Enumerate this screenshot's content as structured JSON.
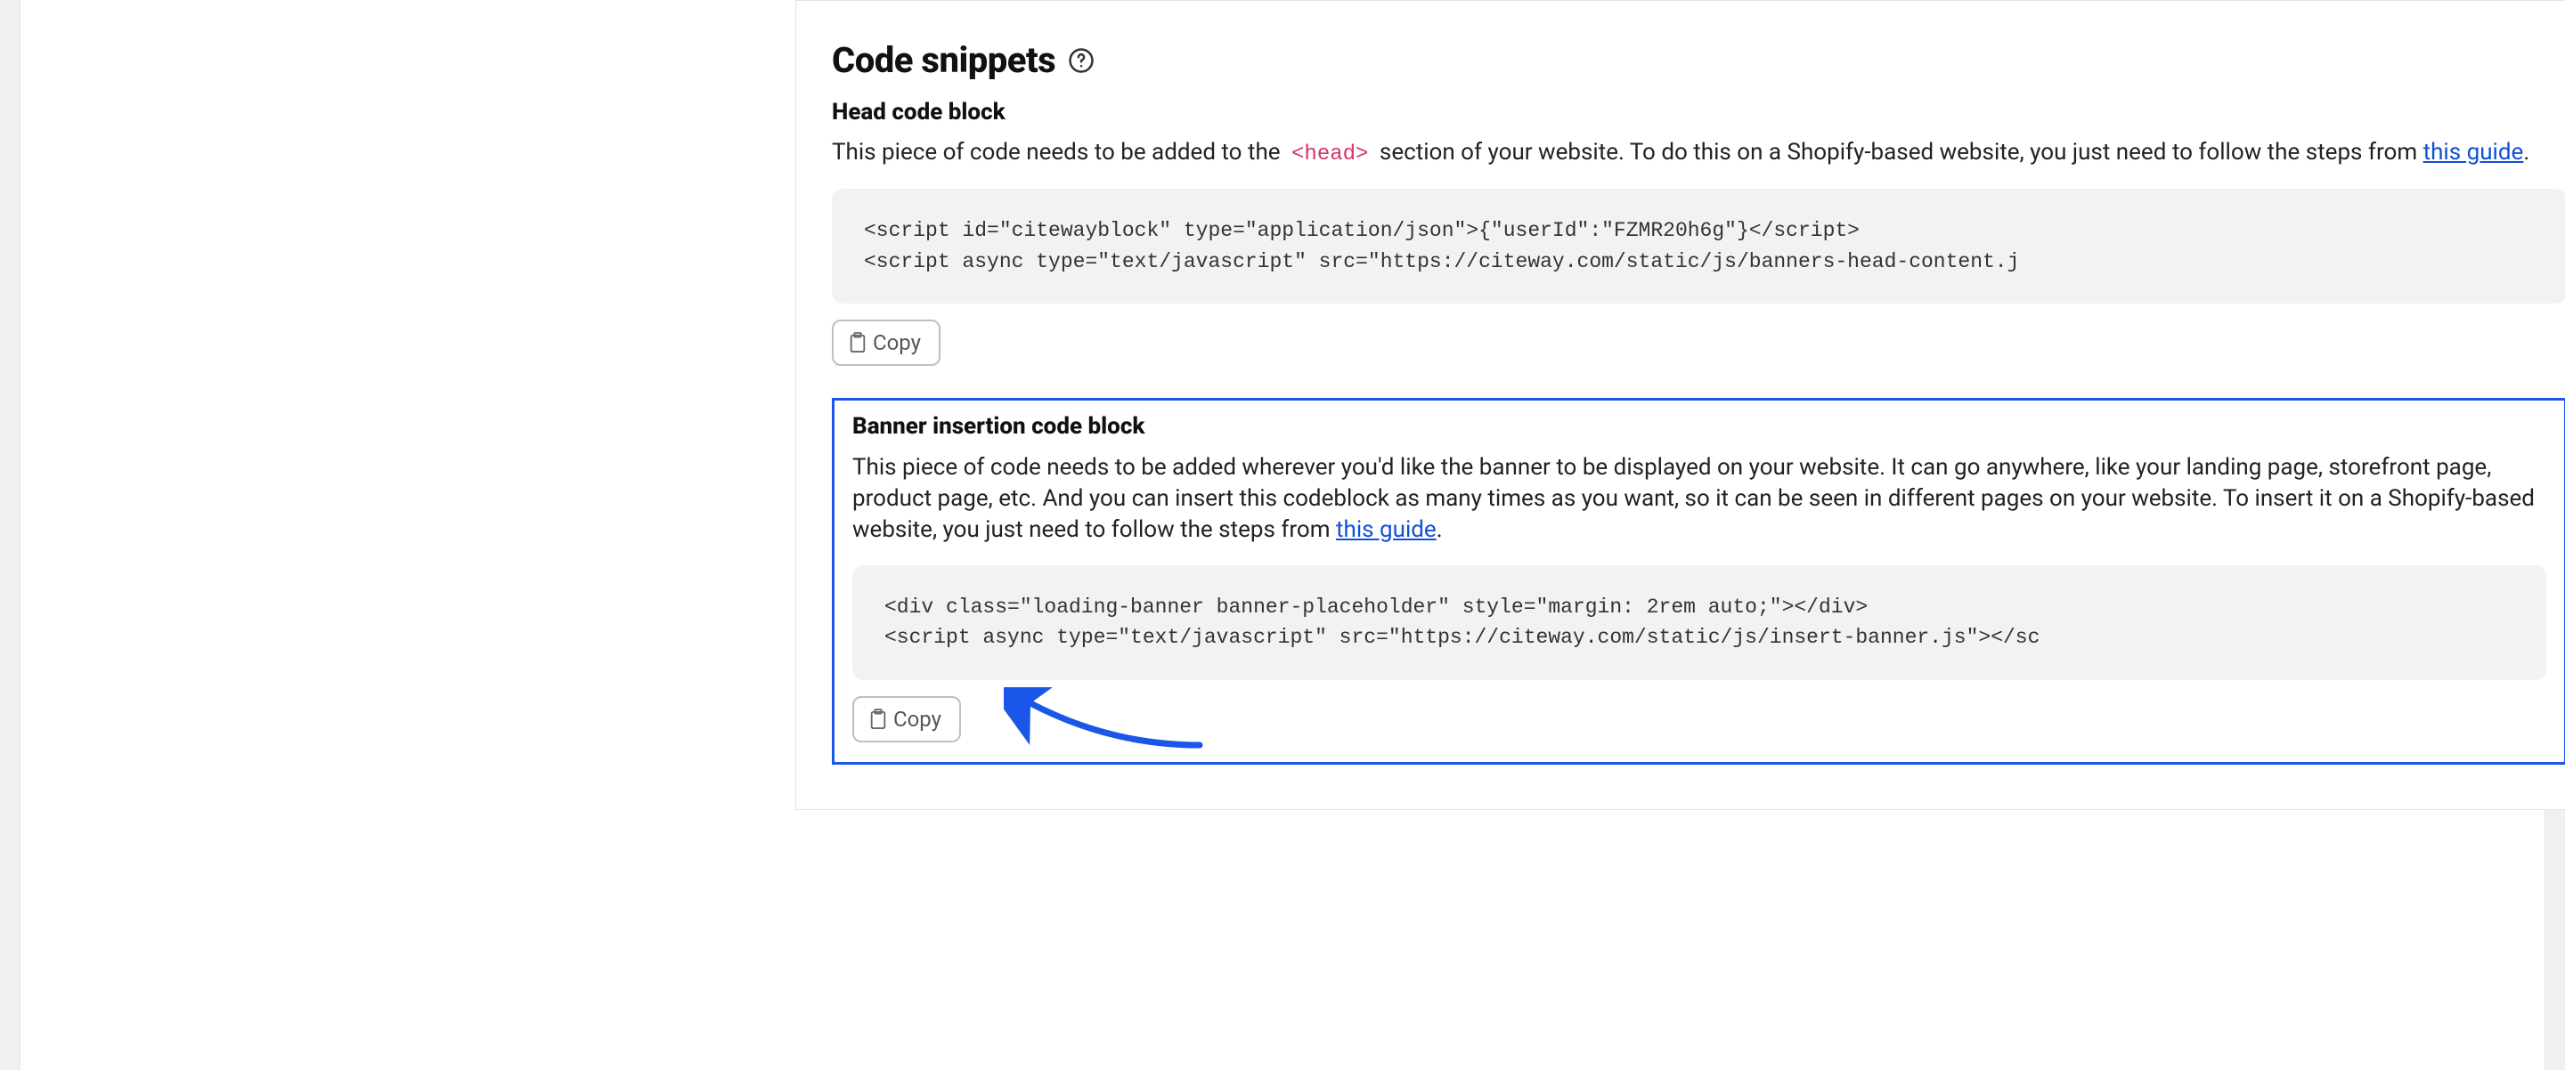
{
  "section": {
    "title": "Code snippets"
  },
  "head_block": {
    "title": "Head code block",
    "desc_before": "This piece of code needs to be added to the ",
    "inline_code": "<head>",
    "desc_after": " section of your website. To do this on a Shopify-based website, you just need to follow the steps from ",
    "link_text": "this guide",
    "desc_end": ".",
    "code": "<script id=\"citewayblock\" type=\"application/json\">{\"userId\":\"FZMR20h6g\"}</script>\n<script async type=\"text/javascript\" src=\"https://citeway.com/static/js/banners-head-content.j",
    "copy_label": "Copy"
  },
  "banner_block": {
    "title": "Banner insertion code block",
    "desc_main": "This piece of code needs to be added wherever you'd like the banner to be displayed on your website. It can go anywhere, like your landing page, storefront page, product page, etc. And you can insert this codeblock as many times as you want, so it can be seen in different pages on your website. To insert it on a Shopify-based website, you just need to follow the steps from ",
    "link_text": "this guide",
    "desc_end": ".",
    "code": "<div class=\"loading-banner banner-placeholder\" style=\"margin: 2rem auto;\"></div>\n<script async type=\"text/javascript\" src=\"https://citeway.com/static/js/insert-banner.js\"></sc",
    "copy_label": "Copy"
  }
}
